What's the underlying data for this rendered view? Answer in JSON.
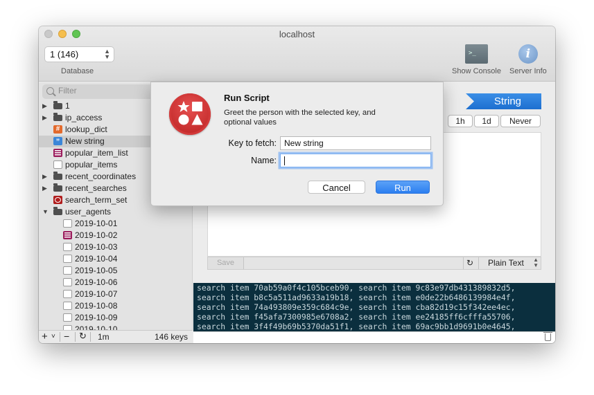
{
  "window": {
    "title": "localhost"
  },
  "toolbar": {
    "database_value": "1 (146)",
    "database_label": "Database",
    "show_console_label": "Show Console",
    "server_info_label": "Server Info"
  },
  "sidebar": {
    "filter_placeholder": "Filter",
    "items": [
      {
        "label": "1",
        "type": "folder",
        "disclosure": "collapsed"
      },
      {
        "label": "ip_access",
        "type": "folder",
        "disclosure": "collapsed"
      },
      {
        "label": "lookup_dict",
        "type": "hash"
      },
      {
        "label": "New string",
        "type": "string",
        "selected": true
      },
      {
        "label": "popular_item_list",
        "type": "list"
      },
      {
        "label": "popular_items",
        "type": "set"
      },
      {
        "label": "recent_coordinates",
        "type": "folder",
        "disclosure": "collapsed"
      },
      {
        "label": "recent_searches",
        "type": "folder",
        "disclosure": "collapsed"
      },
      {
        "label": "search_term_set",
        "type": "zset"
      },
      {
        "label": "user_agents",
        "type": "folder",
        "disclosure": "expanded"
      }
    ],
    "children": [
      {
        "label": "2019-10-01",
        "type": "set"
      },
      {
        "label": "2019-10-02",
        "type": "list"
      },
      {
        "label": "2019-10-03",
        "type": "set"
      },
      {
        "label": "2019-10-04",
        "type": "set"
      },
      {
        "label": "2019-10-05",
        "type": "set"
      },
      {
        "label": "2019-10-06",
        "type": "set"
      },
      {
        "label": "2019-10-07",
        "type": "set"
      },
      {
        "label": "2019-10-08",
        "type": "set"
      },
      {
        "label": "2019-10-09",
        "type": "set"
      },
      {
        "label": "2019-10-10",
        "type": "set"
      }
    ],
    "footer": {
      "add": "+",
      "add_menu": "˅",
      "remove": "−",
      "refresh_interval": "1m",
      "key_count": "146 keys"
    }
  },
  "detail": {
    "type_badge": "String",
    "ttl_options": [
      "1h",
      "1d",
      "Never"
    ],
    "save_label": "Save",
    "format_label": "Plain Text"
  },
  "console": {
    "lines": [
      "search item 70ab59a0f4c105bceb90, search item 9c83e97db431389832d5,",
      "search item b8c5a511ad9633a19b18, search item e0de22b6486139984e4f,",
      "search item 74a493809e359c684c9e, search item cba82d19c15f342ee4ec,",
      "search item f45afa7300985e6708a2, search item ee24185ff6cfffa55706,",
      "search item 3f4f49b69b5370da51f1, search item 69ac9bb1d9691b0e4645,"
    ]
  },
  "dialog": {
    "title": "Run Script",
    "description": "Greet the person with the selected key, and optional values",
    "key_label": "Key to fetch:",
    "key_value": "New string",
    "name_label": "Name:",
    "name_value": "",
    "cancel_label": "Cancel",
    "run_label": "Run"
  },
  "colors": {
    "accent": "#2c7ff0",
    "string_badge": "#1d6fd0",
    "console_bg": "#0b2f3e",
    "script_icon": "#c62828"
  }
}
